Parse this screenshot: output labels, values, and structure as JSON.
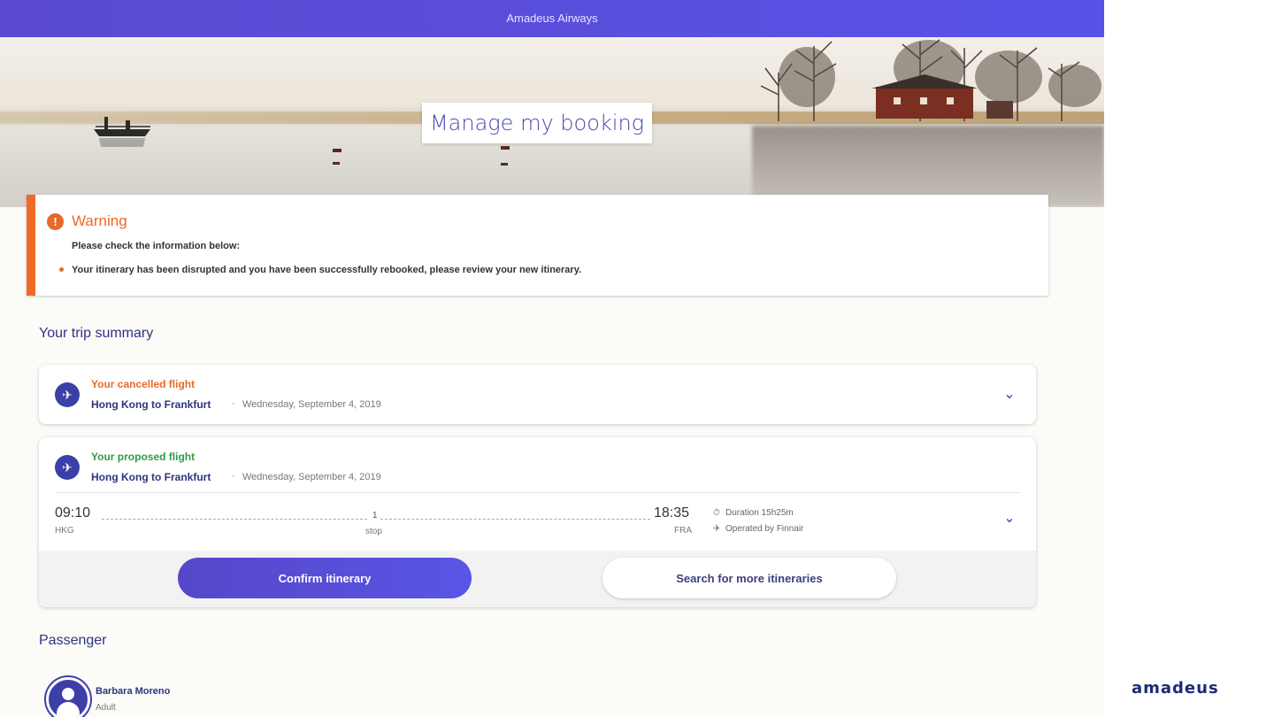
{
  "topbar": {
    "title": "Amadeus Airways"
  },
  "hero": {
    "title": "Manage my booking"
  },
  "warning": {
    "title": "Warning",
    "icon": "exclamation-icon",
    "subtitle": "Please check the information below:",
    "message": "Your itinerary has been disrupted and you have been successfully rebooked, please review your new itinerary."
  },
  "trip": {
    "heading": "Your trip summary",
    "cancelled": {
      "label": "Your cancelled flight",
      "route": "Hong Kong to Frankfurt",
      "separator": "·",
      "date": "Wednesday, September 4, 2019",
      "color": "#e8692a"
    },
    "proposed": {
      "label": "Your proposed flight",
      "route": "Hong Kong to Frankfurt",
      "separator": "·",
      "date": "Wednesday, September 4, 2019",
      "color": "#2e9e44",
      "departure_time": "09:10",
      "departure_code": "HKG",
      "stops_count": "1",
      "stops_label": "stop",
      "arrival_time": "18:35",
      "arrival_code": "FRA",
      "duration": "Duration 15h25m",
      "operated_by": "Operated by Finnair"
    },
    "actions": {
      "confirm_label": "Confirm itinerary",
      "search_label": "Search for more itineraries"
    }
  },
  "passenger": {
    "heading": "Passenger",
    "name": "Barbara Moreno",
    "type": "Adult"
  },
  "brand": {
    "logo_text": "amadeus",
    "accent": "#5a4bd0"
  }
}
